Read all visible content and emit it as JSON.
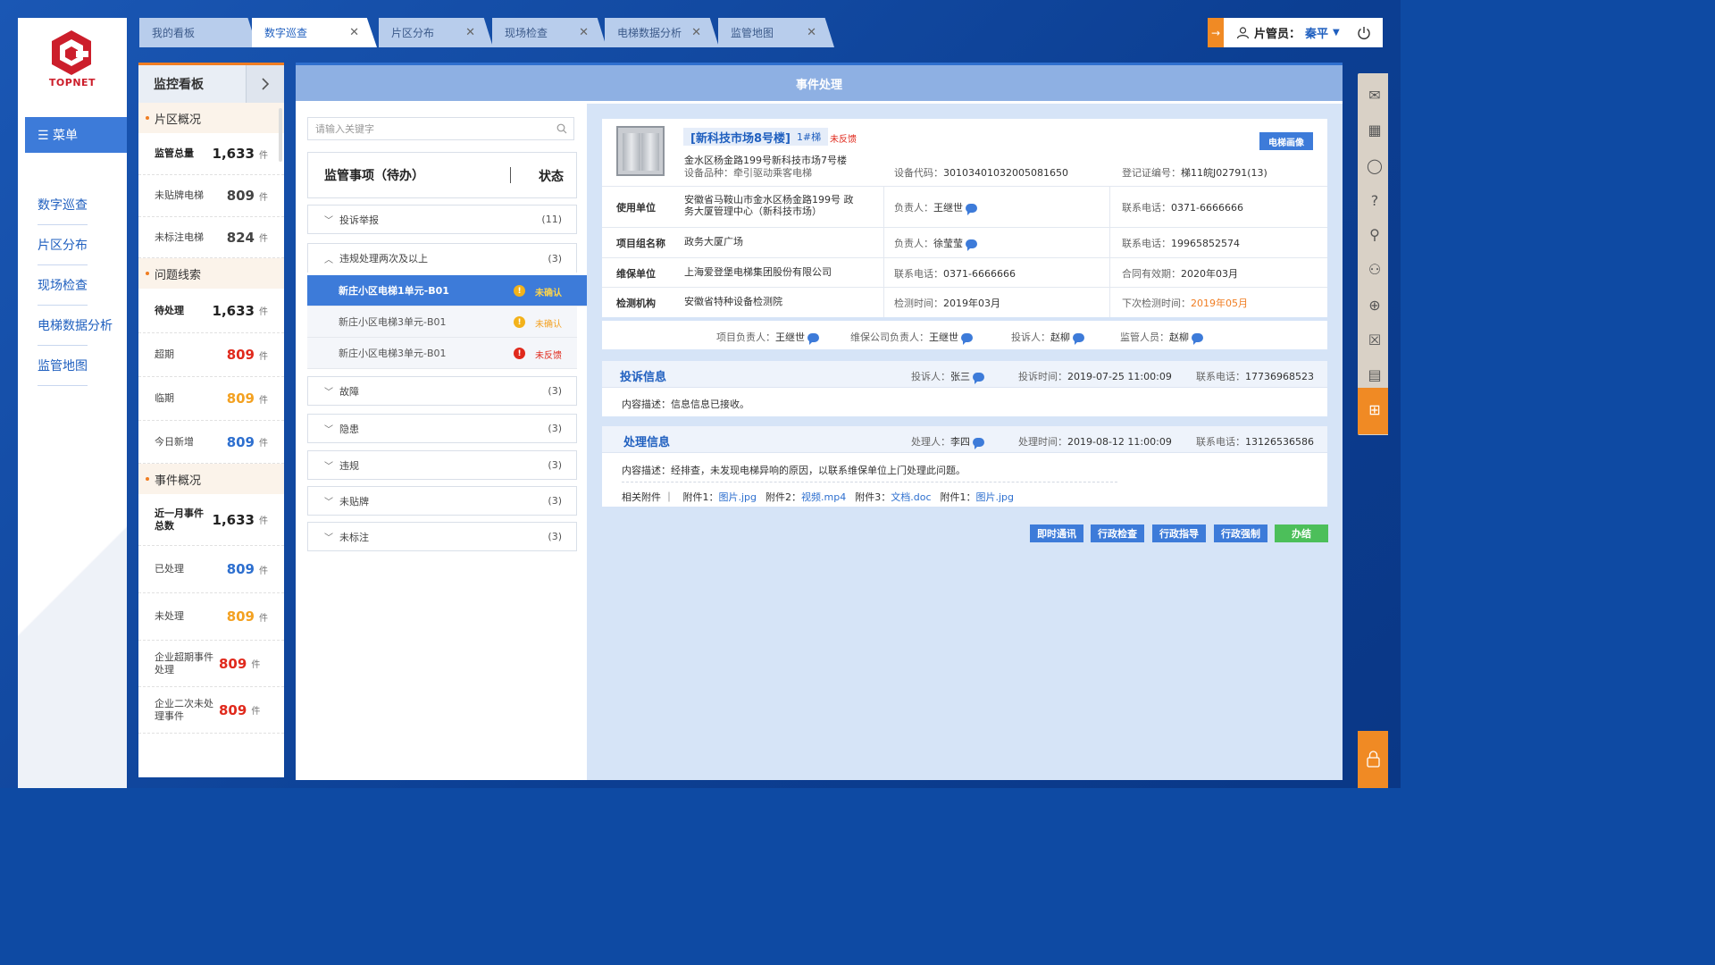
{
  "brand": {
    "name": "TOPNET",
    "color": "#cc1e2b"
  },
  "sidebar": {
    "menu_label": "☰ 菜单",
    "items": [
      "数字巡查",
      "片区分布",
      "现场检查",
      "电梯数据分析",
      "监管地图"
    ]
  },
  "tabs": [
    {
      "label": "我的看板",
      "closable": false,
      "active": false
    },
    {
      "label": "数字巡查",
      "closable": true,
      "active": true
    },
    {
      "label": "片区分布",
      "closable": true,
      "active": false
    },
    {
      "label": "现场检查",
      "closable": true,
      "active": false
    },
    {
      "label": "电梯数据分析",
      "closable": true,
      "active": false
    },
    {
      "label": "监管地图",
      "closable": true,
      "active": false
    }
  ],
  "user": {
    "role": "片管员：",
    "name": "秦平",
    "dropdown": "▼"
  },
  "monitor": {
    "title": "监控看板",
    "sections": [
      {
        "title": "片区概况",
        "rows": [
          {
            "label": "监管总量",
            "value": "1,633",
            "unit": "件",
            "bold": true,
            "color": "black"
          },
          {
            "label": "未贴牌电梯",
            "value": "809",
            "unit": "件",
            "color": "grey"
          },
          {
            "label": "未标注电梯",
            "value": "824",
            "unit": "件",
            "color": "grey"
          }
        ]
      },
      {
        "title": "问题线索",
        "rows": [
          {
            "label": "待处理",
            "value": "1,633",
            "unit": "件",
            "bold": true,
            "color": "black"
          },
          {
            "label": "超期",
            "value": "809",
            "unit": "件",
            "color": "red"
          },
          {
            "label": "临期",
            "value": "809",
            "unit": "件",
            "color": "orange"
          },
          {
            "label": "今日新增",
            "value": "809",
            "unit": "件",
            "color": "blue"
          }
        ]
      },
      {
        "title": "事件概况",
        "rows": [
          {
            "label": "近一月事件总数",
            "value": "1,633",
            "unit": "件",
            "bold": true,
            "color": "black"
          },
          {
            "label": "已处理",
            "value": "809",
            "unit": "件",
            "color": "blue"
          },
          {
            "label": "未处理",
            "value": "809",
            "unit": "件",
            "color": "orange"
          },
          {
            "label": "企业超期事件处理",
            "value": "809",
            "unit": "件",
            "color": "red"
          },
          {
            "label": "企业二次未处理事件",
            "value": "809",
            "unit": "件",
            "color": "red"
          }
        ]
      }
    ]
  },
  "main": {
    "title": "事件处理",
    "search_placeholder": "请输入关键字",
    "todo_title": "监管事项（待办）",
    "status_label": "状态",
    "groups": [
      {
        "label": "投诉举报",
        "count": "(11)",
        "open": false
      },
      {
        "label": "违规处理两次及以上",
        "count": "(3)",
        "open": true
      },
      {
        "label": "故障",
        "count": "(3)",
        "open": false
      },
      {
        "label": "隐患",
        "count": "(3)",
        "open": false
      },
      {
        "label": "违规",
        "count": "(3)",
        "open": false
      },
      {
        "label": "未贴牌",
        "count": "(3)",
        "open": false
      },
      {
        "label": "未标注",
        "count": "(3)",
        "open": false
      }
    ],
    "subitems": [
      {
        "label": "新庄小区电梯1单元-B01",
        "status": "未确认",
        "level": "warn",
        "active": true
      },
      {
        "label": "新庄小区电梯3单元-B01",
        "status": "未确认",
        "level": "warn",
        "active": false
      },
      {
        "label": "新庄小区电梯3单元-B01",
        "status": "未反馈",
        "level": "error",
        "active": false
      }
    ]
  },
  "detail": {
    "title": "[新科技市场8号楼]",
    "unit_no": "1#梯",
    "feedback": "未反馈",
    "portrait_btn": "电梯画像",
    "address": "金水区杨金路199号新科技市场7号楼",
    "device_type": "设备品种：牵引驱动乘客电梯",
    "device_code_label": "设备代码：",
    "device_code": "30103401032005081650",
    "reg_label": "登记证编号：",
    "reg_no": "梯11皖J02791(13)",
    "rows": [
      {
        "key": "使用单位",
        "value": "安徽省马鞍山市金水区杨金路199号 政务大厦管理中心（新科技市场）",
        "c2_label": "负责人：",
        "c2_value": "王继世",
        "c2_chat": true,
        "c3_label": "联系电话：",
        "c3_value": "0371-6666666"
      },
      {
        "key": "项目组名称",
        "value": "政务大厦广场",
        "c2_label": "负责人：",
        "c2_value": "徐莹莹",
        "c2_chat": true,
        "c3_label": "联系电话：",
        "c3_value": "19965852574"
      },
      {
        "key": "维保单位",
        "value": "上海爱登堡电梯集团股份有限公司",
        "c2_label": "联系电话：",
        "c2_value": "0371-6666666",
        "c2_chat": false,
        "c3_label": "合同有效期：",
        "c3_value": "2020年03月"
      },
      {
        "key": "检测机构",
        "value": "安徽省特种设备检测院",
        "c2_label": "检测时间：",
        "c2_value": "2019年03月",
        "c2_chat": false,
        "c3_label": "下次检测时间：",
        "c3_value": "2019年05月"
      }
    ],
    "people": [
      {
        "label": "项目负责人：",
        "name": "王继世"
      },
      {
        "label": "维保公司负责人：",
        "name": "王继世"
      },
      {
        "label": "投诉人：",
        "name": "赵柳"
      },
      {
        "label": "监管人员：",
        "name": "赵柳"
      }
    ],
    "complaint": {
      "title": "投诉信息",
      "person_label": "投诉人：",
      "person": "张三",
      "time_label": "投诉时间：",
      "time": "2019-07-25   11:00:09",
      "phone_label": "联系电话：",
      "phone": "17736968523",
      "desc": "内容描述：信息信息已接收。"
    },
    "handling": {
      "title": "处理信息",
      "person_label": "处理人：",
      "person": "李四",
      "time_label": "处理时间：",
      "time": "2019-08-12   11:00:09",
      "phone_label": "联系电话：",
      "phone": "13126536586",
      "desc": "内容描述：经排查，未发现电梯异响的原因，以联系维保单位上门处理此问题。",
      "attach_label": "相关附件 ｜",
      "attachments": [
        {
          "label": "附件1：",
          "file": "图片.jpg"
        },
        {
          "label": "附件2：",
          "file": "视频.mp4"
        },
        {
          "label": "附件3：",
          "file": "文档.doc"
        },
        {
          "label": "附件1：",
          "file": "图片.jpg"
        }
      ]
    },
    "actions": [
      {
        "label": "即时通讯",
        "color": "#3d7bd9"
      },
      {
        "label": "行政检查",
        "color": "#3d7bd9"
      },
      {
        "label": "行政指导",
        "color": "#3d7bd9"
      },
      {
        "label": "行政强制",
        "color": "#3d7bd9"
      },
      {
        "label": "办结",
        "color": "#4cbf5a"
      }
    ]
  },
  "rail_icons": [
    "mail-icon",
    "calendar-icon",
    "chat-icon",
    "help-icon",
    "stamp-icon",
    "user-search-icon",
    "globe-icon",
    "close-box-icon",
    "document-icon",
    "add-icon",
    "lock-icon"
  ]
}
